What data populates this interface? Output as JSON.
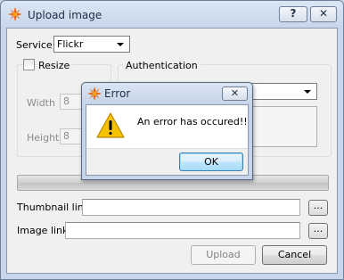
{
  "window": {
    "title": "Upload image",
    "help_label": "?",
    "close_label": "✕",
    "service_label": "Service",
    "service_value": "Flickr",
    "resize_label": "Resize",
    "width_label": "Width",
    "width_value": "8",
    "height_label": "Height",
    "height_value": "8",
    "authentication_label": "Authentication",
    "thumbnail_label": "Thumbnail link",
    "thumbnail_value": "",
    "image_label": "Image link",
    "image_value": "",
    "browse_label": "...",
    "upload_label": "Upload",
    "cancel_label": "Cancel"
  },
  "dialog": {
    "title": "Error",
    "close_label": "✕",
    "message": "An error has occured!!",
    "ok_label": "OK"
  },
  "colors": {
    "accent": "#3c7fb1",
    "warning": "#f6c100",
    "app_icon": "#e8651a"
  }
}
